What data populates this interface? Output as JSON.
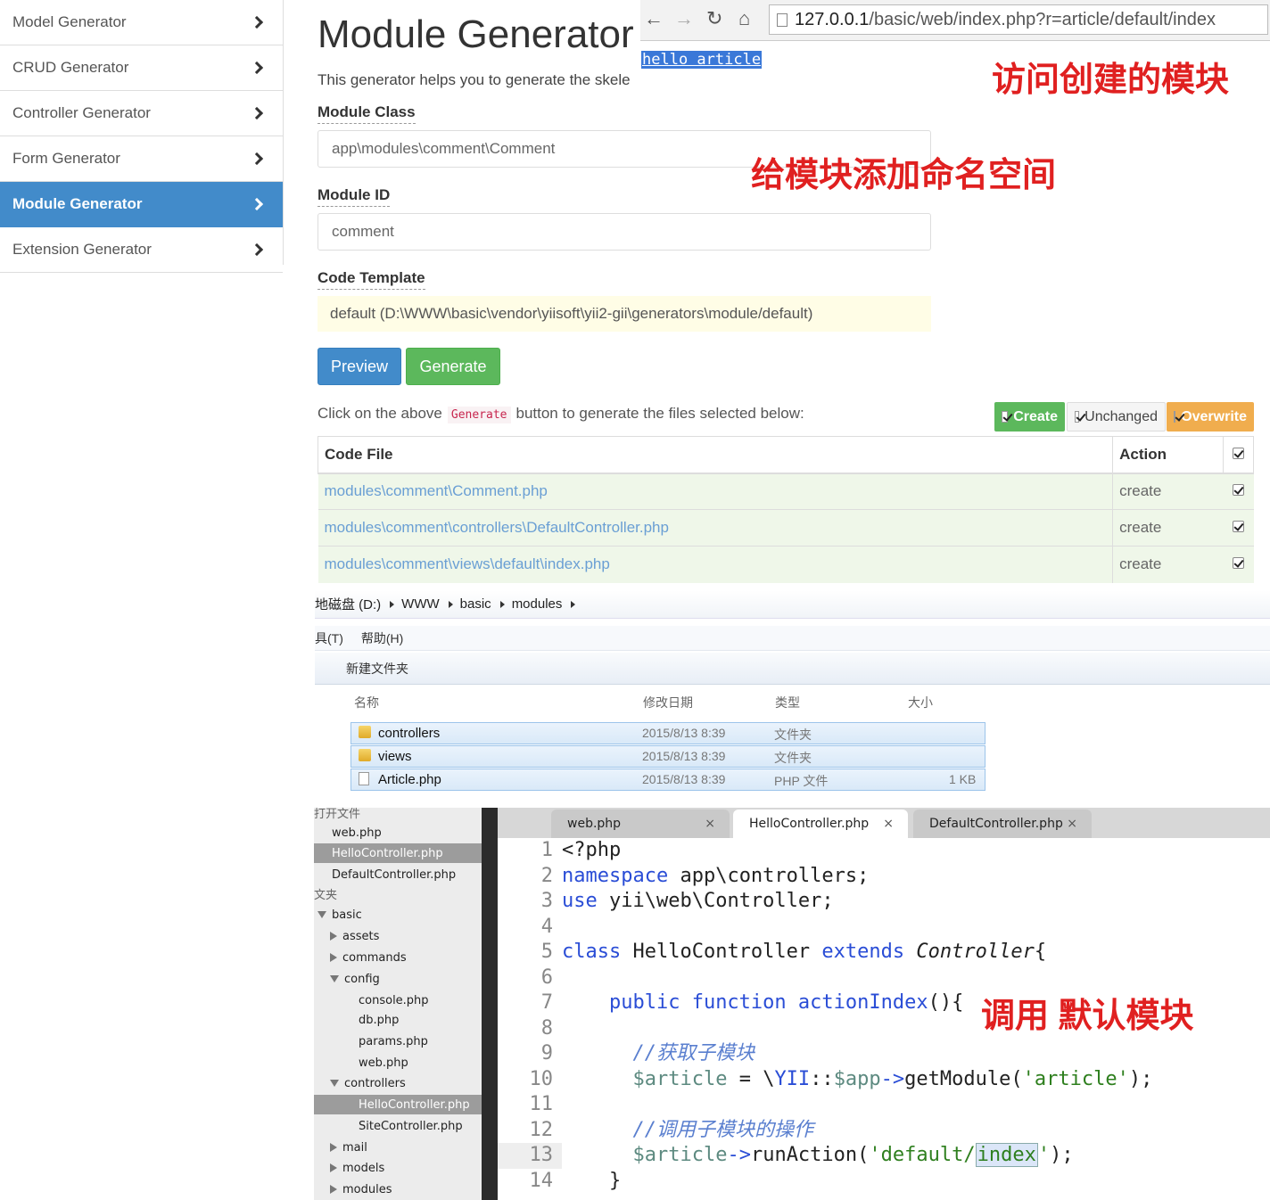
{
  "sidebar": {
    "items": [
      {
        "label": "Model Generator"
      },
      {
        "label": "CRUD Generator"
      },
      {
        "label": "Controller Generator"
      },
      {
        "label": "Form Generator"
      },
      {
        "label": "Module Generator",
        "active": true
      },
      {
        "label": "Extension Generator"
      }
    ]
  },
  "form": {
    "title": "Module Generator",
    "description": "This generator helps you to generate the skele",
    "module_class_label": "Module Class",
    "module_class_value": "app\\modules\\comment\\Comment",
    "module_id_label": "Module ID",
    "module_id_value": "comment",
    "code_template_label": "Code Template",
    "code_template_value": "default (D:\\WWW\\basic\\vendor\\yiisoft\\yii2-gii\\generators\\module/default)",
    "preview_label": "Preview",
    "generate_label": "Generate",
    "hint_before": "Click on the above",
    "hint_code": "Generate",
    "hint_after": "button to generate the files selected below:",
    "legend_create": "Create",
    "legend_unchanged": "Unchanged",
    "legend_overwrite": "Overwrite"
  },
  "files_table": {
    "headers": [
      "Code File",
      "Action"
    ],
    "rows": [
      {
        "file": "modules\\comment\\Comment.php",
        "action": "create"
      },
      {
        "file": "modules\\comment\\controllers\\DefaultController.php",
        "action": "create"
      },
      {
        "file": "modules\\comment\\views\\default\\index.php",
        "action": "create"
      }
    ]
  },
  "browser": {
    "url_host": "127.0.0.1",
    "url_path": "/basic/web/index.php?r=article/default/index",
    "page_text": "hello article"
  },
  "annotations": {
    "visit": "访问创建的模块",
    "namespace": "给模块添加命名空间",
    "call": "调用 默认模块"
  },
  "explorer": {
    "breadcrumb": [
      "地磁盘 (D:)",
      "WWW",
      "basic",
      "modules"
    ],
    "menu": [
      "具(T)",
      "帮助(H)"
    ],
    "new_folder": "新建文件夹",
    "columns": [
      "名称",
      "修改日期",
      "类型",
      "大小"
    ],
    "rows": [
      {
        "name": "controllers",
        "date": "2015/8/13 8:39",
        "type": "文件夹",
        "size": "",
        "kind": "folder"
      },
      {
        "name": "views",
        "date": "2015/8/13 8:39",
        "type": "文件夹",
        "size": "",
        "kind": "folder"
      },
      {
        "name": "Article.php",
        "date": "2015/8/13 8:39",
        "type": "PHP 文件",
        "size": "1 KB",
        "kind": "file"
      }
    ]
  },
  "editor": {
    "open_files_label": "打开文件",
    "folders_label": "文夹",
    "tree": [
      {
        "label": "web.php",
        "indent": 1
      },
      {
        "label": "HelloController.php",
        "indent": 1,
        "selected": true
      },
      {
        "label": "DefaultController.php",
        "indent": 1
      },
      {
        "label": "basic",
        "indent": 0,
        "arrow": "d"
      },
      {
        "label": "assets",
        "indent": 1,
        "arrow": "r"
      },
      {
        "label": "commands",
        "indent": 1,
        "arrow": "r"
      },
      {
        "label": "config",
        "indent": 1,
        "arrow": "d"
      },
      {
        "label": "console.php",
        "indent": 2
      },
      {
        "label": "db.php",
        "indent": 2
      },
      {
        "label": "params.php",
        "indent": 2
      },
      {
        "label": "web.php",
        "indent": 2
      },
      {
        "label": "controllers",
        "indent": 1,
        "arrow": "d"
      },
      {
        "label": "HelloController.php",
        "indent": 2,
        "selected": true
      },
      {
        "label": "SiteController.php",
        "indent": 2
      },
      {
        "label": "mail",
        "indent": 1,
        "arrow": "r"
      },
      {
        "label": "models",
        "indent": 1,
        "arrow": "r"
      },
      {
        "label": "modules",
        "indent": 1,
        "arrow": "r"
      }
    ],
    "tabs": [
      {
        "label": "web.php"
      },
      {
        "label": "HelloController.php",
        "active": true
      },
      {
        "label": "DefaultController.php"
      }
    ],
    "line_numbers": [
      "1",
      "2",
      "3",
      "4",
      "5",
      "6",
      "7",
      "8",
      "9",
      "10",
      "11",
      "12",
      "13",
      "14"
    ]
  }
}
